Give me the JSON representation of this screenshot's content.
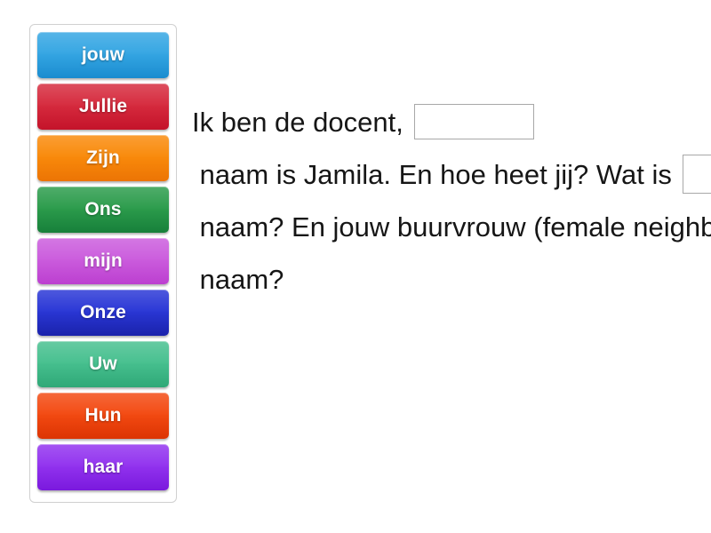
{
  "page": {
    "background_color": "#ffffff",
    "text_color": "#161616"
  },
  "tile_panel": {
    "name": "word-bank",
    "border_color": "#d0d0d0",
    "tiles": [
      {
        "label": "jouw",
        "color_top": "#35a6e3",
        "color_bottom": "#1a8ccf"
      },
      {
        "label": "Jullie",
        "color_top": "#d62b3e",
        "color_bottom": "#c4132a"
      },
      {
        "label": "Zijn",
        "color_top": "#f98a0b",
        "color_bottom": "#ec7404"
      },
      {
        "label": "Ons",
        "color_top": "#2c9c4c",
        "color_bottom": "#17803a"
      },
      {
        "label": "mijn",
        "color_top": "#cb5cdd",
        "color_bottom": "#bc3fd0"
      },
      {
        "label": "Onze",
        "color_top": "#2a37d6",
        "color_bottom": "#1a22ab"
      },
      {
        "label": "Uw",
        "color_top": "#47c08f",
        "color_bottom": "#2fa877"
      },
      {
        "label": "Hun",
        "color_top": "#f34a12",
        "color_bottom": "#dc3403"
      },
      {
        "label": "haar",
        "color_top": "#9233ef",
        "color_bottom": "#7a19dd"
      }
    ]
  },
  "sentence": {
    "name": "fill-in-the-blank-sentence",
    "segments": [
      {
        "type": "text",
        "value": "Ik ben de docent, "
      },
      {
        "type": "blank",
        "value": "",
        "placeholder": ""
      },
      {
        "type": "text",
        "value": " naam is Jamila. En hoe heet jij? Wat is "
      },
      {
        "type": "blank",
        "value": "",
        "placeholder": ""
      },
      {
        "type": "text",
        "value": " naam? En jouw buurvrouw (female neighbor), weet jij hoe zij heet? Wat is "
      },
      {
        "type": "blank",
        "value": "",
        "placeholder": ""
      },
      {
        "type": "text",
        "value": " naam?"
      }
    ],
    "lines": [
      "Ik ben de docent,",
      "naam is Jamila. En hoe heet",
      "jij? Wat is      naam?",
      "En jouw buurvrouw (female",
      "neighbor), weet jij hoe zij",
      "heet? Wat is      naam?"
    ],
    "blank_border_color": "#a8a8a8",
    "blank_fill_color": "#ffffff"
  }
}
